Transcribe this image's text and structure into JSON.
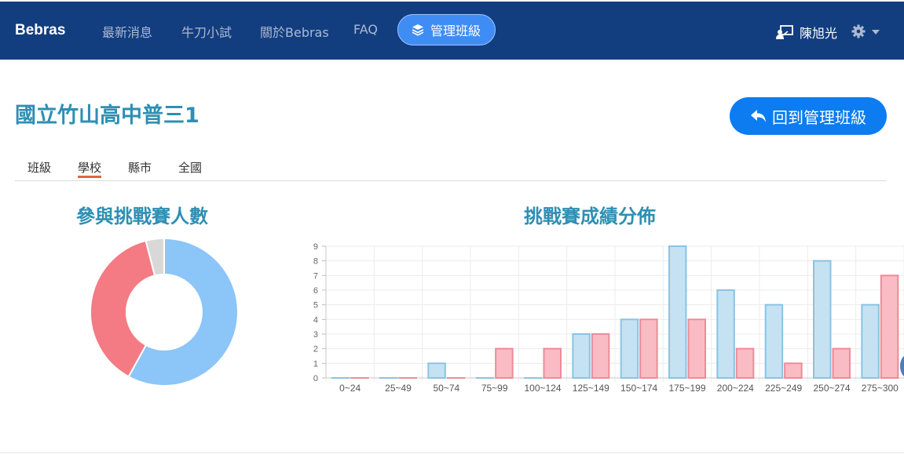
{
  "navbar": {
    "brand": "Bebras",
    "links": [
      "最新消息",
      "牛刀小試",
      "關於Bebras",
      "FAQ"
    ],
    "active": "管理班級",
    "user": "陳旭光",
    "colors": {
      "bg": "#123e80",
      "active_bg": "#3f8cf5"
    }
  },
  "page": {
    "title": "國立竹山高中普三1",
    "back_button": "回到管理班級"
  },
  "tabs": [
    {
      "label": "班級",
      "active": false
    },
    {
      "label": "學校",
      "active": true
    },
    {
      "label": "縣市",
      "active": false
    },
    {
      "label": "全國",
      "active": false
    }
  ],
  "sections": {
    "participants_title": "參與挑戰賽人數",
    "distribution_title": "挑戰賽成績分佈"
  },
  "chart_data": [
    {
      "type": "pie",
      "variant": "doughnut",
      "slices": [
        {
          "value": 58,
          "color": "#8cc5f7"
        },
        {
          "value": 38,
          "color": "#f47b84"
        },
        {
          "value": 4,
          "color": "#d8d8d8"
        }
      ]
    },
    {
      "type": "bar",
      "categories": [
        "0~24",
        "25~49",
        "50~74",
        "75~99",
        "100~124",
        "125~149",
        "150~174",
        "175~199",
        "200~224",
        "225~249",
        "250~274",
        "275~300"
      ],
      "ylim": [
        0,
        9
      ],
      "yticks": [
        0,
        1,
        2,
        3,
        4,
        5,
        6,
        7,
        8,
        9
      ],
      "grid": true,
      "series": [
        {
          "values": [
            0,
            0,
            1,
            0,
            0,
            3,
            4,
            9,
            6,
            5,
            8,
            5
          ],
          "fill": "#c4e2f2",
          "stroke": "#8cc3e3"
        },
        {
          "values": [
            0,
            0,
            0,
            2,
            2,
            3,
            4,
            4,
            2,
            1,
            2,
            7
          ],
          "fill": "#f9bcc4",
          "stroke": "#ee8b98"
        }
      ]
    }
  ]
}
